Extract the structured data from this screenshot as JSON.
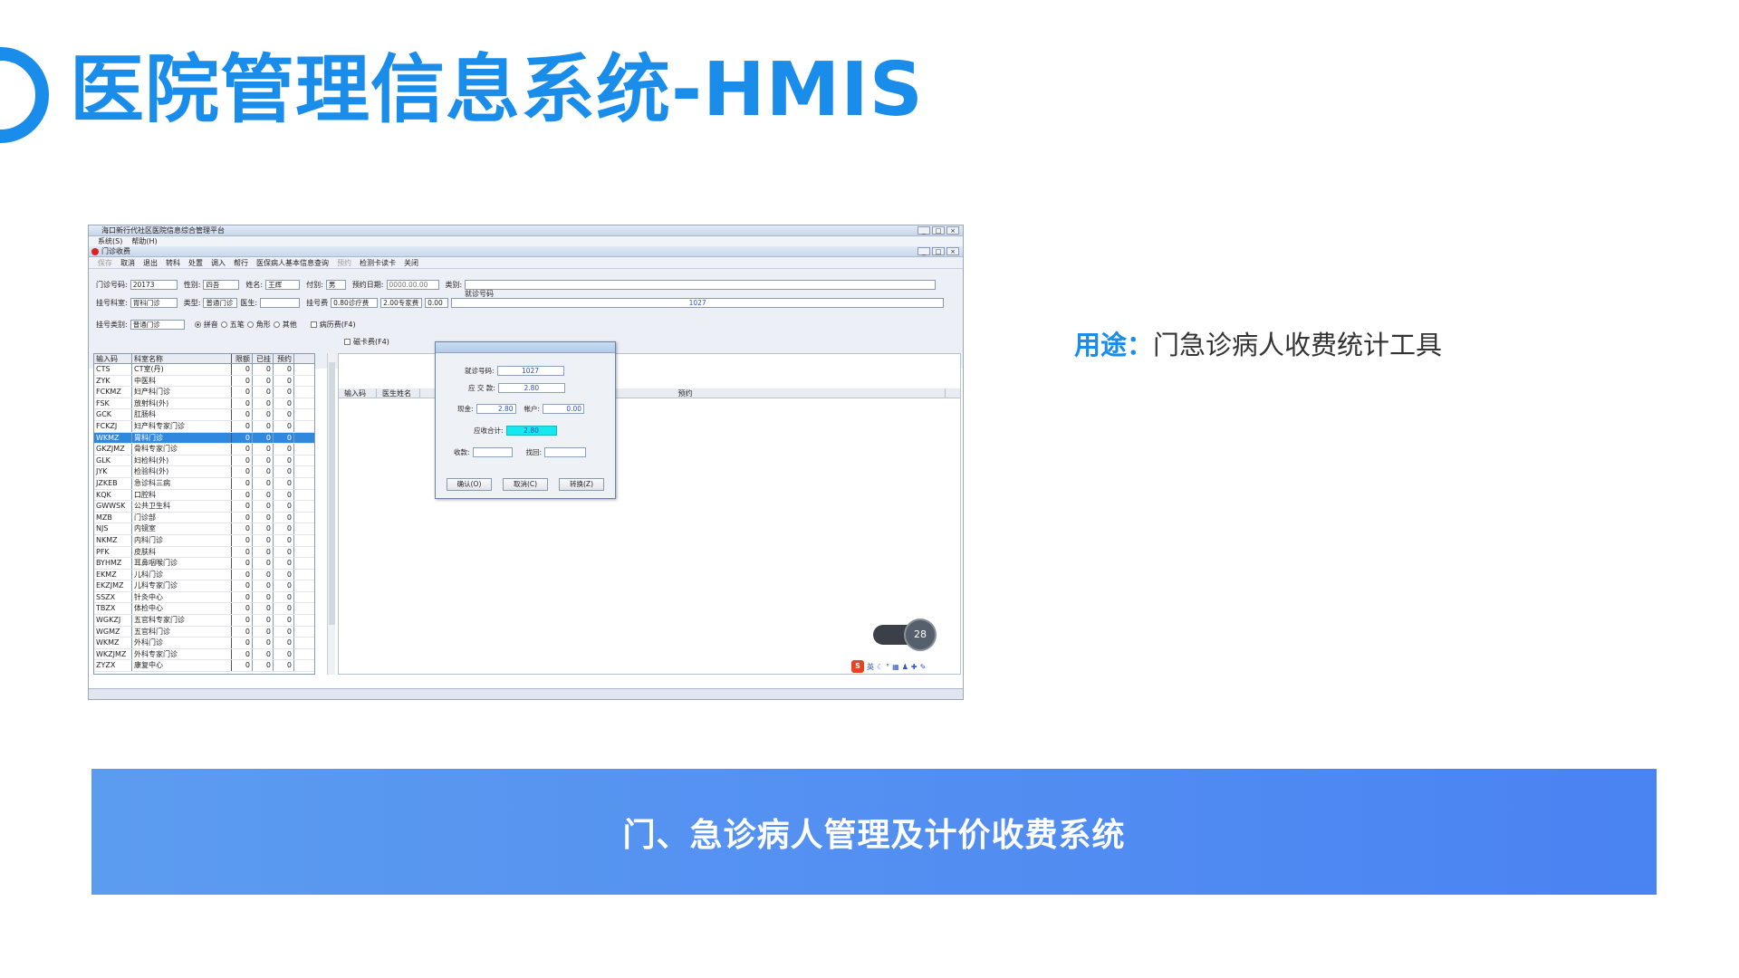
{
  "slide": {
    "title": "医院管理信息系统-HMIS",
    "usage_label": "用途：",
    "usage_text": "门急诊病人收费统计工具",
    "banner_text": "门、急诊病人管理及计价收费系统"
  },
  "app": {
    "window_title": "海口新行代社区医院信息综合管理平台",
    "menu": [
      "系统(S)",
      "帮助(H)"
    ],
    "subwindow_title": "门诊收费",
    "toolbar": [
      {
        "label": "保存",
        "disabled": true
      },
      {
        "label": "取消",
        "disabled": false
      },
      {
        "label": "退出",
        "disabled": false
      },
      {
        "label": "转科",
        "disabled": false
      },
      {
        "label": "处置",
        "disabled": false
      },
      {
        "label": "调入",
        "disabled": false
      },
      {
        "label": "帮行",
        "disabled": false
      },
      {
        "label": "医保病人基本信息查询",
        "disabled": false
      },
      {
        "label": "预约",
        "disabled": true
      },
      {
        "label": "检测卡读卡",
        "disabled": false
      },
      {
        "label": "关闭",
        "disabled": false
      }
    ],
    "form": {
      "clinic_no_label": "门诊号码:",
      "clinic_no": "20173",
      "gender_label": "性别:",
      "gender": "四吾",
      "name_label": "姓名:",
      "name": "王辉",
      "age_label": "付别:",
      "age": "男",
      "appt_date_label": "预约日期:",
      "appt_date": "0000.00.00",
      "type_label": "类别:",
      "visit_no_label": "就诊号码",
      "reg_dept_label": "挂号科室:",
      "reg_dept": "胃科门诊",
      "category_label": "类型:",
      "category": "普通门诊",
      "doctor_label": "医生:",
      "reg_fee_label": "挂号费",
      "reg_fee": "0.80诊疗费",
      "fee2": "2.00专家费",
      "fee3": "0.00",
      "visit_no": "1027",
      "reg_type_label": "挂号类别:",
      "reg_type": "普通门诊",
      "radios": [
        "拼音",
        "五笔",
        "角形",
        "其他"
      ],
      "check_history": "病历费(F4)",
      "check_card": "磁卡费(F4)"
    },
    "grid": {
      "headers": [
        "输入码",
        "科室名称",
        "限额",
        "已挂",
        "预约"
      ],
      "rows": [
        [
          "CTS",
          "CT室(丹)",
          "0",
          "0",
          "0"
        ],
        [
          "ZYK",
          "中医科",
          "0",
          "0",
          "0"
        ],
        [
          "FCKMZ",
          "妇产科门诊",
          "0",
          "0",
          "0"
        ],
        [
          "FSK",
          "放射科(外)",
          "0",
          "0",
          "0"
        ],
        [
          "GCK",
          "肛肠科",
          "0",
          "0",
          "0"
        ],
        [
          "FCKZJ",
          "妇产科专家门诊",
          "0",
          "0",
          "0"
        ],
        [
          "WKMZ",
          "胃科门诊",
          "0",
          "0",
          "0"
        ],
        [
          "GKZJMZ",
          "骨科专家门诊",
          "0",
          "0",
          "0"
        ],
        [
          "GLK",
          "妇检科(外)",
          "0",
          "0",
          "0"
        ],
        [
          "JYK",
          "检验科(外)",
          "0",
          "0",
          "0"
        ],
        [
          "JZKEB",
          "急诊科三病",
          "0",
          "0",
          "0"
        ],
        [
          "KQK",
          "口腔科",
          "0",
          "0",
          "0"
        ],
        [
          "GWWSK",
          "公共卫生科",
          "0",
          "0",
          "0"
        ],
        [
          "MZB",
          "门诊部",
          "0",
          "0",
          "0"
        ],
        [
          "NJS",
          "内镜室",
          "0",
          "0",
          "0"
        ],
        [
          "NKMZ",
          "内科门诊",
          "0",
          "0",
          "0"
        ],
        [
          "PFK",
          "皮肤科",
          "0",
          "0",
          "0"
        ],
        [
          "BYHMZ",
          "耳鼻咽喉门诊",
          "0",
          "0",
          "0"
        ],
        [
          "EKMZ",
          "儿科门诊",
          "0",
          "0",
          "0"
        ],
        [
          "EKZJMZ",
          "儿科专家门诊",
          "0",
          "0",
          "0"
        ],
        [
          "SSZX",
          "针灸中心",
          "0",
          "0",
          "0"
        ],
        [
          "TBZX",
          "体检中心",
          "0",
          "0",
          "0"
        ],
        [
          "WGKZJ",
          "五官科专家门诊",
          "0",
          "0",
          "0"
        ],
        [
          "WGMZ",
          "五官科门诊",
          "0",
          "0",
          "0"
        ],
        [
          "WKMZ",
          "外科门诊",
          "0",
          "0",
          "0"
        ],
        [
          "WKZJMZ",
          "外科专家门诊",
          "0",
          "0",
          "0"
        ],
        [
          "ZYZX",
          "康复中心",
          "0",
          "0",
          "0"
        ]
      ],
      "selected_index": 6
    },
    "right_headers": [
      "输入码",
      "医生姓名",
      "预约"
    ],
    "dialog": {
      "visit_no_label": "就诊号码:",
      "visit_no": "1027",
      "due_label": "应 交 款:",
      "due": "2.80",
      "cash_label": "现金:",
      "cash": "2.80",
      "account_label": "帐户:",
      "account": "0.00",
      "total_label": "应收合计:",
      "total": "2.80",
      "received_label": "收款:",
      "change_label": "找回:",
      "btn_ok": "确认(O)",
      "btn_cancel": "取消(C)",
      "btn_switch": "转换(Z)"
    },
    "gauge_value": "28",
    "ime_label": "英",
    "colors": {
      "accent": "#1a8dea",
      "selection": "#3088de",
      "total_highlight": "#16e8f0"
    }
  }
}
